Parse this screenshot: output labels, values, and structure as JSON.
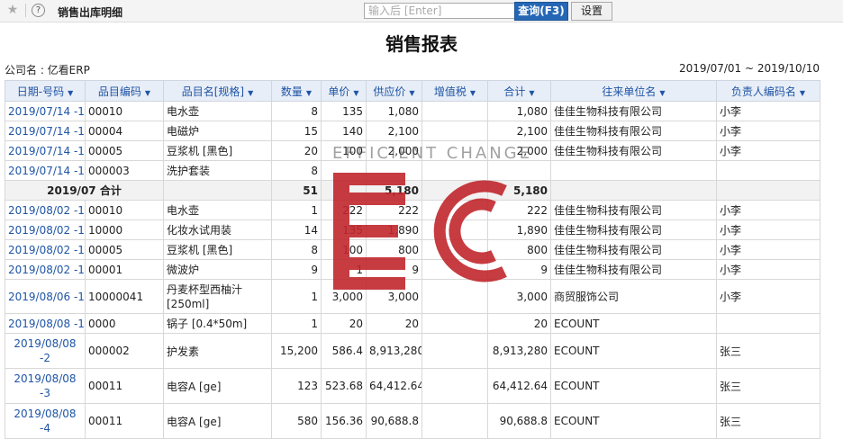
{
  "toolbar": {
    "page_title": "销售出库明细",
    "search_placeholder": "输入后 [Enter]",
    "query_label": "查询(F3)",
    "settings_label": "设置"
  },
  "report": {
    "title": "销售报表",
    "company": "公司名 : 亿看ERP",
    "date_range": "2019/07/01 ~ 2019/10/10"
  },
  "columns": [
    "日期-号码",
    "品目编码",
    "品目名[规格]",
    "数量",
    "单价",
    "供应价",
    "增值税",
    "合计",
    "往来单位名",
    "负责人编码名"
  ],
  "rows": [
    [
      "2019/07/14 -1",
      "00010",
      "电水壶",
      "8",
      "135",
      "1,080",
      "",
      "1,080",
      "佳佳生物科技有限公司",
      "小李"
    ],
    [
      "2019/07/14 -1",
      "00004",
      "电磁炉",
      "15",
      "140",
      "2,100",
      "",
      "2,100",
      "佳佳生物科技有限公司",
      "小李"
    ],
    [
      "2019/07/14 -1",
      "00005",
      "豆浆机 [黑色]",
      "20",
      "100",
      "2,000",
      "",
      "2,000",
      "佳佳生物科技有限公司",
      "小李"
    ],
    [
      "2019/07/14 -1",
      "000003",
      "洗护套装",
      "8",
      "",
      "",
      "",
      "",
      "",
      ""
    ],
    [
      "",
      "2019/07 合计",
      "",
      "51",
      "",
      "5,180",
      "",
      "5,180",
      "",
      ""
    ],
    [
      "2019/08/02 -1",
      "00010",
      "电水壶",
      "1",
      "222",
      "222",
      "",
      "222",
      "佳佳生物科技有限公司",
      "小李"
    ],
    [
      "2019/08/02 -1",
      "10000",
      "化妆水试用装",
      "14",
      "135",
      "1,890",
      "",
      "1,890",
      "佳佳生物科技有限公司",
      "小李"
    ],
    [
      "2019/08/02 -1",
      "00005",
      "豆浆机 [黑色]",
      "8",
      "100",
      "800",
      "",
      "800",
      "佳佳生物科技有限公司",
      "小李"
    ],
    [
      "2019/08/02 -1",
      "00001",
      "微波炉",
      "9",
      "1",
      "9",
      "",
      "9",
      "佳佳生物科技有限公司",
      "小李"
    ],
    [
      "2019/08/06 -1",
      "10000041",
      "丹麦杯型西柚汁 [250ml]",
      "1",
      "3,000",
      "3,000",
      "",
      "3,000",
      "商贸服饰公司",
      "小李"
    ],
    [
      "2019/08/08 -1",
      "0000",
      "锅子 [0.4*50m]",
      "1",
      "20",
      "20",
      "",
      "20",
      "ECOUNT",
      ""
    ],
    [
      "2019/08/08 -2",
      "000002",
      "护发素",
      "15,200",
      "586.4",
      "8,913,280",
      "",
      "8,913,280",
      "ECOUNT",
      "张三"
    ],
    [
      "2019/08/08 -3",
      "00011",
      "电容A [ge]",
      "123",
      "523.68",
      "64,412.64",
      "",
      "64,412.64",
      "ECOUNT",
      "张三"
    ],
    [
      "2019/08/08 -4",
      "00011",
      "电容A [ge]",
      "580",
      "156.36",
      "90,688.8",
      "",
      "90,688.8",
      "ECOUNT",
      "张三"
    ]
  ],
  "watermark": {
    "text": "EFFICIENT CHANGE",
    "logo": "EC",
    "color": "#c0272d"
  }
}
